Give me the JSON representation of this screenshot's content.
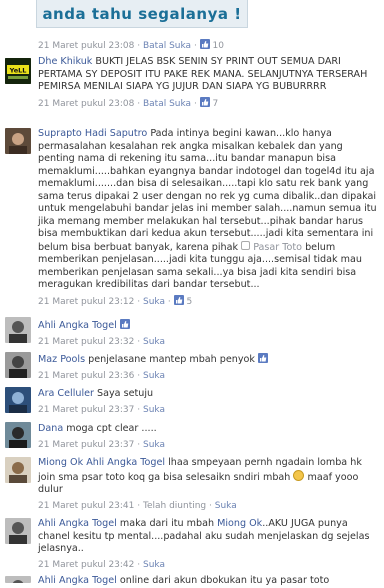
{
  "banner": {
    "text": "anda tahu segalanya !"
  },
  "top_meta": {
    "time": "21 Maret pukul 23:08",
    "sep1": " · ",
    "unlike": "Batal Suka",
    "sep2": " · ",
    "likes": "10"
  },
  "comments": [
    {
      "author": "Dhe Khikuk",
      "text": "BUKTI JELAS BSK SENIN SY PRINT OUT SEMUA DARI PERTAMA SY DEPOSIT ITU PAKE REK MANA. SELANJUTNYA TERSERAH PEMIRSA MENILAI SIAPA YG JUJUR DAN SIAPA YG BUBURRRR",
      "time": "21 Maret pukul 23:08",
      "action": "Batal Suka",
      "likes": "7"
    },
    {
      "author": "Suprapto Hadi Saputro",
      "text_a": "Pada intinya begini kawan...klo hanya permasalahan kesalahan rek angka misalkan kebalek dan yang penting nama di rekening itu sama...itu bandar manapun bisa memaklumi.....bahkan eyangnya bandar indotogel dan togel4d itu aja memaklumi.......dan bisa di selesaikan.....tapi klo satu rek bank yang sama terus dipakai 2 user dengan no rek yg cuma dibalik..dan dipakai untuk mengelabuhi bandar jelas ini member salah....namun semua itu jika memang member melakukan hal tersebut...pihak bandar harus bisa membuktikan dari kedua akun tersebut.....jadi kita sementara ini belum bisa berbuat banyak, karena pihak",
      "pasar_label": "Pasar Toto",
      "text_b": "belum memberikan penjelasan.....jadi kita tunggu aja....semisal tidak mau memberikan penjelasan sama sekali...ya bisa jadi kita sendiri bisa meragukan kredibilitas dari bandar tersebut...",
      "time": "21 Maret pukul 23:12",
      "action": "Suka",
      "likes": "5"
    },
    {
      "author": "Ahli Angka Togel",
      "text": "",
      "time": "21 Maret pukul 23:32",
      "action": "Suka",
      "likes": ""
    },
    {
      "author": "Maz Pools",
      "text": "penjelasane mantep mbah penyok",
      "time": "21 Maret pukul 23:36",
      "action": "Suka",
      "likes": ""
    },
    {
      "author": "Ara Celluler",
      "text": "Saya setuju",
      "time": "21 Maret pukul 23:37",
      "action": "Suka",
      "likes": ""
    },
    {
      "author": "Dana",
      "text": "moga cpt clear .....",
      "time": "21 Maret pukul 23:37",
      "action": "Suka",
      "likes": ""
    },
    {
      "author": "Miong Ok Ahli Angka Togel",
      "text_a": "lhaa smpeyaan pernh ngadain lomba hk join sma psar toto koq ga bisa selesaikn sndiri mbah",
      "text_b": "maaf yooo dulur",
      "time": "21 Maret pukul 23:41",
      "action": "Telah diunting",
      "like_label": "Suka"
    },
    {
      "author": "Ahli Angka Togel",
      "text_a": "maka dari itu mbah",
      "mention": "Miong Ok",
      "text_b": "..AKU JUGA punya chanel kesitu tp mental....padahal aku sudah menjelaskan dg sejelas jelasnya..",
      "time": "21 Maret pukul 23:42",
      "action": "Suka"
    },
    {
      "author": "Ahli Angka Togel",
      "text": "online dari akun dbokukan itu ya pasar toto"
    }
  ],
  "colors": {
    "link": "#3b5998",
    "meta": "#90949c",
    "banner_text": "#1b6f97"
  }
}
